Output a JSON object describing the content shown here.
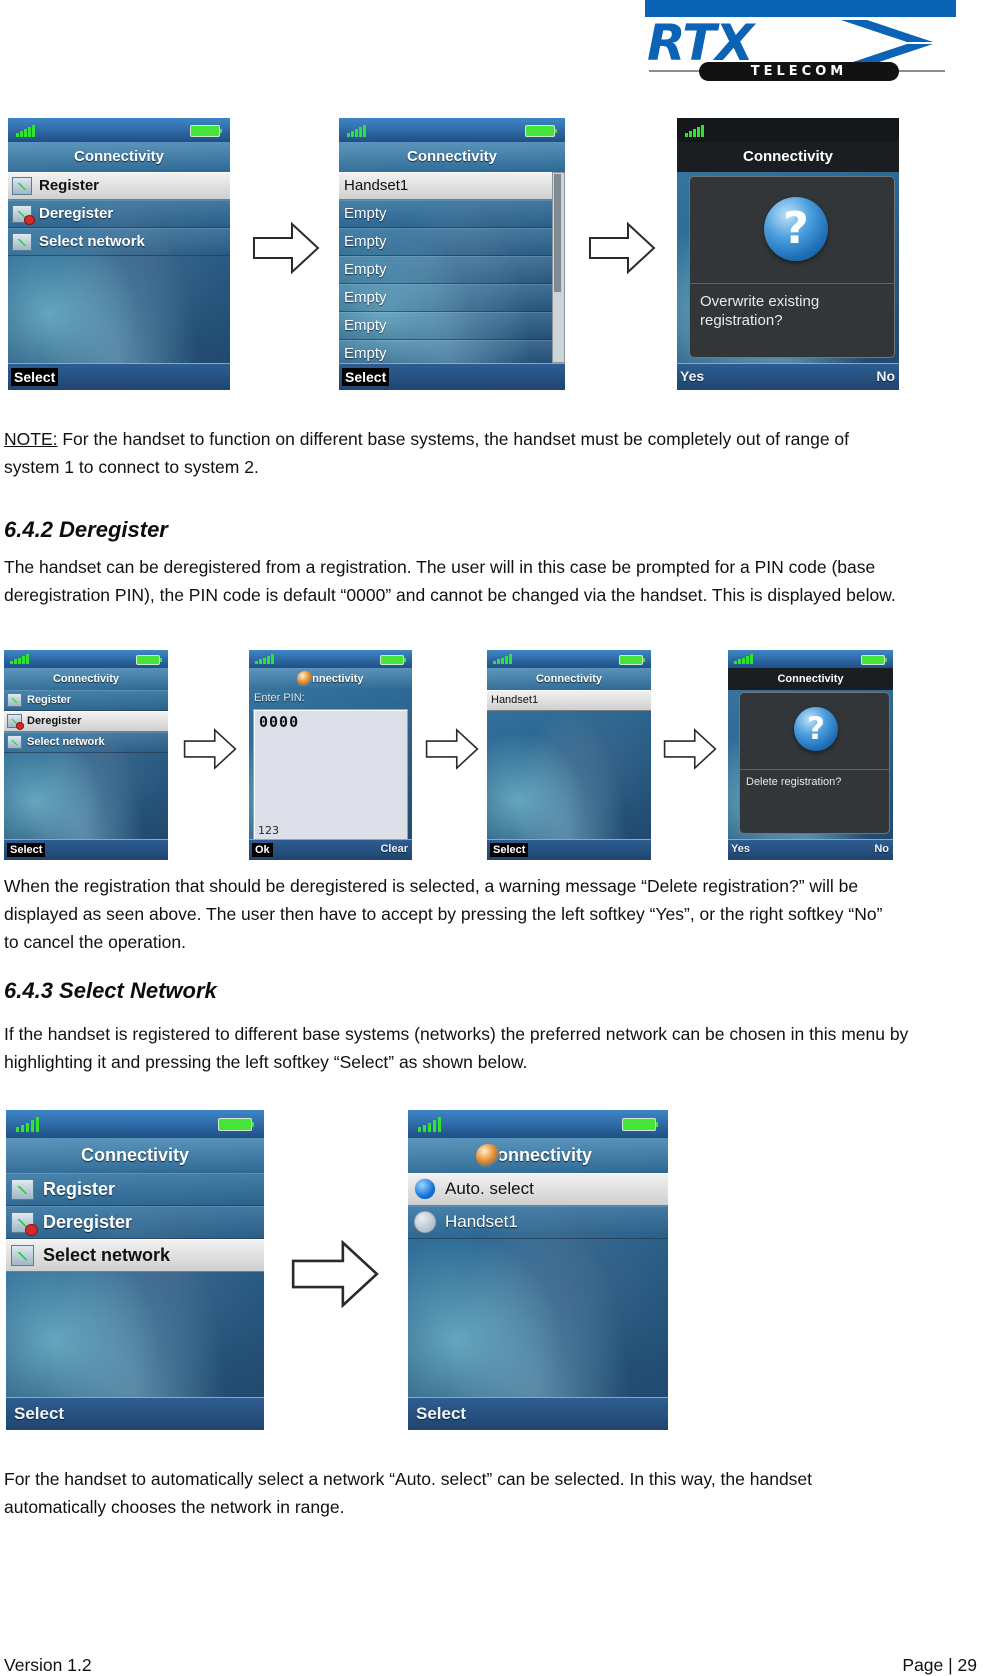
{
  "logo": {
    "brand": "RTX",
    "sub": "TELECOM",
    "accent": "#0b63b5"
  },
  "paragraphs": {
    "note_label": "NOTE:",
    "note_body": " For the handset to function on different base systems, the handset must be completely out of range of system 1 to connect to system 2.",
    "h_642": "6.4.2 Deregister",
    "p_642": "The handset can be deregistered from a registration. The user will in this case be prompted for a PIN code (base deregistration PIN), the PIN code is default “0000” and cannot be changed via the handset. This is displayed below.",
    "p_after_row2": "When the registration that should be deregistered is selected, a warning message “Delete registration?” will be displayed as seen above.  The user then have to accept by pressing the left softkey “Yes”, or the right softkey “No” to cancel the operation.",
    "h_643": "6.4.3 Select Network",
    "p_643": "If the handset is registered to different base systems (networks) the preferred network can be chosen in this menu by highlighting it and pressing the left softkey “Select” as shown below.",
    "p_final": "For the handset to automatically select a network “Auto. select” can be selected. In this way, the handset automatically chooses the network in range."
  },
  "footer": {
    "version": "Version 1.2",
    "page": "Page | 29"
  },
  "row1": {
    "s1": {
      "title": "Connectivity",
      "items": [
        {
          "label": "Register",
          "icon": "network-icon",
          "selected": true
        },
        {
          "label": "Deregister",
          "icon": "network-deny-icon",
          "selected": false
        },
        {
          "label": "Select network",
          "icon": "network-icon",
          "selected": false
        }
      ],
      "softkey_left": "Select"
    },
    "s2": {
      "title": "Connectivity",
      "items": [
        {
          "label": "Handset1",
          "selected": true
        },
        {
          "label": "Empty",
          "selected": false
        },
        {
          "label": "Empty",
          "selected": false
        },
        {
          "label": "Empty",
          "selected": false
        },
        {
          "label": "Empty",
          "selected": false
        },
        {
          "label": "Empty",
          "selected": false
        },
        {
          "label": "Empty",
          "selected": false
        }
      ],
      "softkey_left": "Select"
    },
    "s3": {
      "title": "Connectivity",
      "dialog_icon": "question-icon",
      "dialog_text": "Overwrite existing registration?",
      "softkey_left": "Yes",
      "softkey_right": "No"
    }
  },
  "row2": {
    "s1": {
      "title": "Connectivity",
      "items": [
        {
          "label": "Register",
          "icon": "network-icon",
          "selected": false
        },
        {
          "label": "Deregister",
          "icon": "network-deny-icon",
          "selected": true
        },
        {
          "label": "Select network",
          "icon": "network-icon",
          "selected": false
        }
      ],
      "softkey_left": "Select"
    },
    "s2": {
      "title": "Connectivity",
      "title_icon": "globe-icon",
      "sublabel": "Enter PIN:",
      "value": "0000",
      "input_mode": "123",
      "softkey_left": "Ok",
      "softkey_right": "Clear"
    },
    "s3": {
      "title": "Connectivity",
      "items": [
        {
          "label": "Handset1",
          "selected": true
        }
      ],
      "softkey_left": "Select"
    },
    "s4": {
      "title": "Connectivity",
      "dialog_icon": "question-icon",
      "dialog_text": "Delete registration?",
      "softkey_left": "Yes",
      "softkey_right": "No"
    }
  },
  "row3": {
    "s1": {
      "title": "Connectivity",
      "items": [
        {
          "label": "Register",
          "icon": "network-icon",
          "selected": false
        },
        {
          "label": "Deregister",
          "icon": "network-deny-icon",
          "selected": false
        },
        {
          "label": "Select network",
          "icon": "network-icon",
          "selected": true
        }
      ],
      "softkey_left": "Select"
    },
    "s2": {
      "title": "Connectivity",
      "title_icon": "globe-icon",
      "items": [
        {
          "label": "Auto. select",
          "radio": "on",
          "selected": true
        },
        {
          "label": "Handset1",
          "radio": "off",
          "selected": false
        }
      ],
      "softkey_left": "Select"
    }
  }
}
